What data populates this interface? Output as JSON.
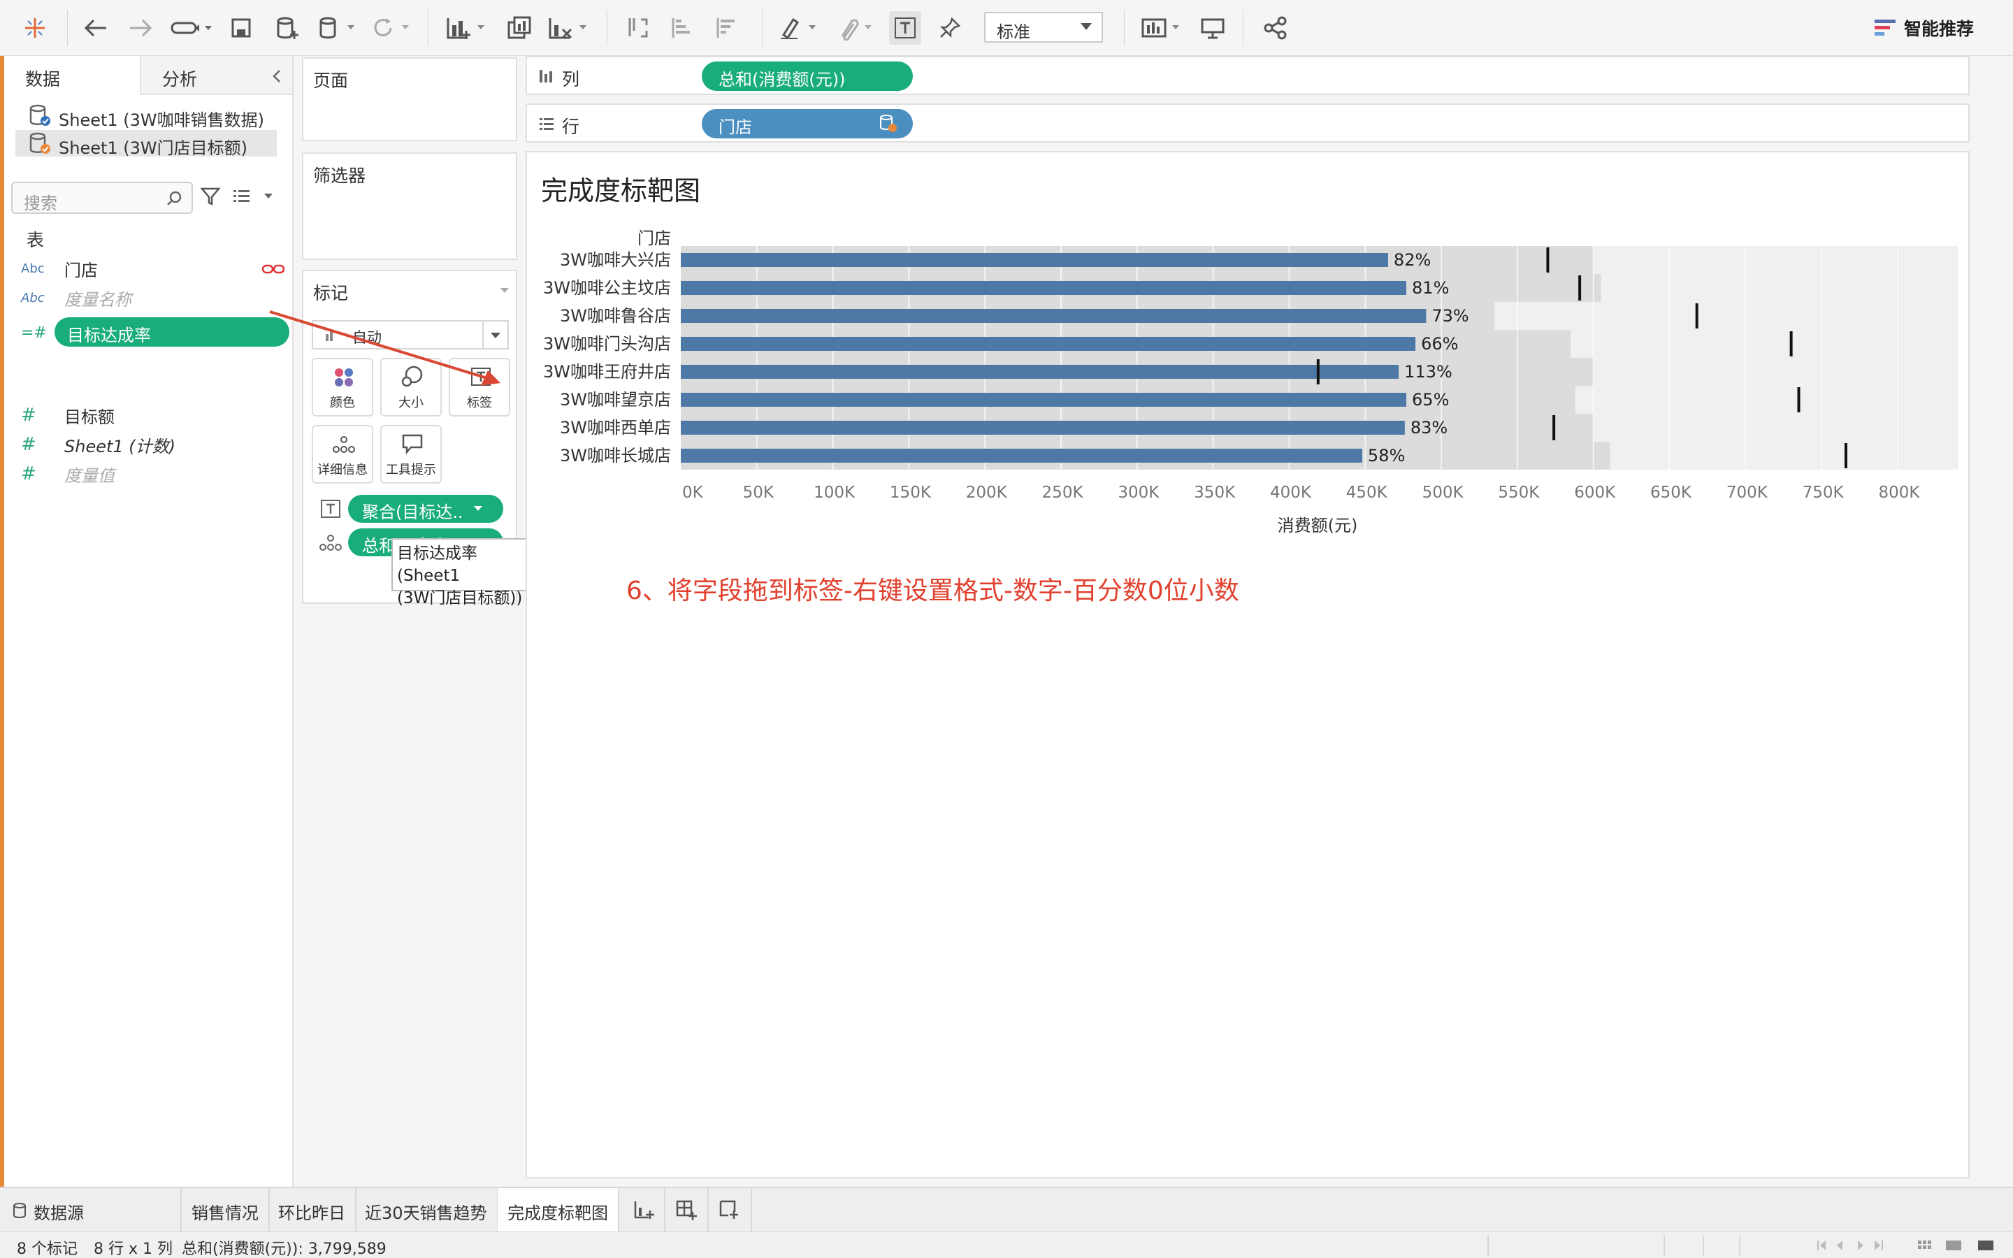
{
  "toolbar": {
    "view_select": "标准",
    "smart_recommend": "智能推荐"
  },
  "data_pane": {
    "tab_data": "数据",
    "tab_analysis": "分析",
    "sources": [
      "Sheet1 (3W咖啡销售数据)",
      "Sheet1 (3W门店目标额)"
    ],
    "search_placeholder": "搜索",
    "section_title": "表",
    "fields": [
      {
        "type": "Abc",
        "name": "门店"
      },
      {
        "type": "Abc",
        "name": "度量名称"
      },
      {
        "type": "#",
        "name": "目标达成率"
      },
      {
        "type": "#",
        "name": "目标额"
      },
      {
        "type": "#",
        "name": "Sheet1 (计数)"
      },
      {
        "type": "#",
        "name": "度量值"
      }
    ]
  },
  "shelves": {
    "pages_title": "页面",
    "filters_title": "筛选器",
    "marks_title": "标记",
    "marks_type": "自动",
    "mark_buttons": [
      "颜色",
      "大小",
      "标签",
      "详细信息",
      "工具提示"
    ],
    "label_pill": "聚合(目标达..",
    "detail_pill": "总和(目标额)",
    "columns_label": "列",
    "columns_pill": "总和(消费额(元))",
    "rows_label": "行",
    "rows_pill": "门店"
  },
  "tooltip": {
    "line1": "目标达成率 (Sheet1",
    "line2": "(3W门店目标额))"
  },
  "sheet": {
    "title": "完成度标靶图",
    "annotation": "6、将字段拖到标签-右键设置格式-数字-百分数0位小数"
  },
  "chart_data": {
    "type": "bar",
    "orientation": "horizontal",
    "row_header": "门店",
    "categories": [
      "3W咖啡大兴店",
      "3W咖啡公主坟店",
      "3W咖啡鲁谷店",
      "3W咖啡门头沟店",
      "3W咖啡王府井店",
      "3W咖啡望京店",
      "3W咖啡西单店",
      "3W咖啡长城店"
    ],
    "values": [
      465000,
      477000,
      490000,
      483000,
      472000,
      477000,
      476000,
      448000
    ],
    "labels": [
      "82%",
      "81%",
      "73%",
      "66%",
      "113%",
      "65%",
      "83%",
      "58%"
    ],
    "targets": [
      570000,
      591000,
      668000,
      730000,
      419000,
      735000,
      574000,
      766000
    ],
    "band_ends": [
      600000,
      605000,
      535000,
      585000,
      600000,
      588000,
      600000,
      611000
    ],
    "xlabel": "消费额(元)",
    "ylabel": "",
    "xlim": [
      0,
      840000
    ],
    "x_ticks": [
      "0K",
      "50K",
      "100K",
      "150K",
      "200K",
      "250K",
      "300K",
      "350K",
      "400K",
      "450K",
      "500K",
      "550K",
      "600K",
      "650K",
      "700K",
      "750K",
      "800K"
    ],
    "bar_color": "#4e79a7",
    "band_color": "#dcdcdc",
    "target_color": "#111111"
  },
  "bottom_tabs": {
    "datasource": "数据源",
    "sheets": [
      "销售情况",
      "环比昨日",
      "近30天销售趋势",
      "完成度标靶图"
    ]
  },
  "status": {
    "marks": "8 个标记",
    "dims": "8 行 x 1 列",
    "sum": "总和(消费额(元)): 3,799,589"
  }
}
